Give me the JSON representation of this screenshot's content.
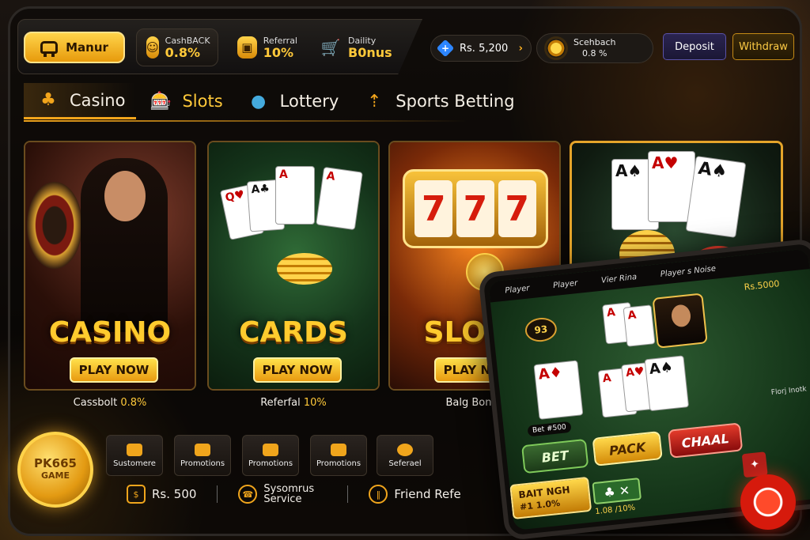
{
  "colors": {
    "accent": "#f2a51c",
    "gold": "#ffc93a",
    "deposit_border": "#5a52a8"
  },
  "header": {
    "menu_label": "Manur",
    "cashback": {
      "label": "CashBACK",
      "value": "0.8%"
    },
    "referral": {
      "label": "Referral",
      "value": "10%"
    },
    "daily": {
      "label": "Daility",
      "value": "B0nus"
    },
    "balance": "Rs. 5,200",
    "scheback": {
      "label": "Scehbach",
      "value": "0.8 %"
    },
    "deposit_label": "Deposit",
    "withdraw_label": "Withdraw"
  },
  "tabs": [
    {
      "label": "Casino",
      "icon": "casino-icon"
    },
    {
      "label": "Slots",
      "icon": "slots-icon"
    },
    {
      "label": "Lottery",
      "icon": "lottery-icon"
    },
    {
      "label": "Sports Betting",
      "icon": "sports-icon"
    }
  ],
  "cards": [
    {
      "title": "CASINO",
      "button": "PLAY NOW",
      "caption_pre": "Cassbolt",
      "caption_val": "0.8%"
    },
    {
      "title": "CARDS",
      "button": "PLAY NOW",
      "caption_pre": "Referfal",
      "caption_val": "10%"
    },
    {
      "title": "SLOTS",
      "button": "PLAY NOW",
      "caption_pre": "Balg Bonus",
      "caption_val": ""
    }
  ],
  "shortcuts": [
    "Sustomere",
    "Promotions",
    "Promotions",
    "Promotions",
    "Seferael"
  ],
  "bottom": {
    "amount": "Rs. 500",
    "service": "Sysomrus Service",
    "friend": "Friend Refe"
  },
  "coin": {
    "line1": "PK665",
    "line2": "GAME"
  },
  "tablet": {
    "bar": [
      "Player",
      "Player",
      "Vier Rina",
      "Player s Noise"
    ],
    "amount": "Rs.5000",
    "badge": "93",
    "bet": "BET",
    "pack": "PACK",
    "chaal": "CHAAL",
    "bait_title": "BAIT NGH",
    "bait_sub": "#1 1.0%",
    "bottom_val": "1.08 /10%",
    "bet_small": "Bet #500",
    "right_label": "Florj Inotk"
  }
}
